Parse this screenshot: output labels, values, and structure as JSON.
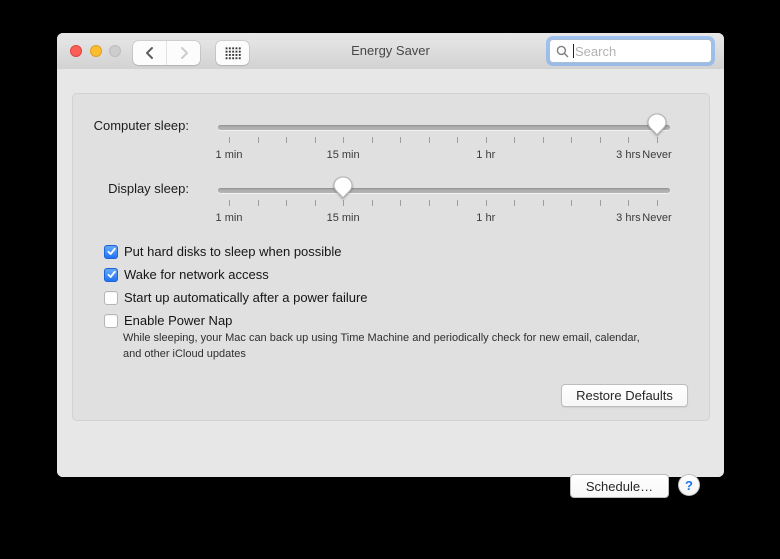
{
  "window": {
    "title": "Energy Saver"
  },
  "titlebar": {
    "close_label": "close",
    "minimize_label": "minimize",
    "zoom_label": "zoom-disabled",
    "search": {
      "placeholder": "Search"
    }
  },
  "sliders": {
    "tick_count": 16,
    "tick_labels": [
      {
        "text": "1 min",
        "tick": 0
      },
      {
        "text": "15 min",
        "tick": 4
      },
      {
        "text": "1 hr",
        "tick": 9
      },
      {
        "text": "3 hrs",
        "tick": 14
      },
      {
        "text": "Never",
        "tick": 15
      }
    ],
    "items": [
      {
        "id": "computer-sleep",
        "label": "Computer sleep:",
        "value": "Never",
        "thumb_tick": 15
      },
      {
        "id": "display-sleep",
        "label": "Display sleep:",
        "value": "15 min",
        "thumb_tick": 4
      }
    ]
  },
  "checkboxes": [
    {
      "label": "Put hard disks to sleep when possible",
      "checked": true
    },
    {
      "label": "Wake for network access",
      "checked": true
    },
    {
      "label": "Start up automatically after a power failure",
      "checked": false
    },
    {
      "label": "Enable Power Nap",
      "checked": false
    }
  ],
  "power_nap_note": "While sleeping, your Mac can back up using Time Machine and periodically check for new email, calendar, and other iCloud updates",
  "buttons": {
    "restore_defaults": "Restore Defaults",
    "schedule": "Schedule…",
    "help": "?"
  },
  "colors": {
    "checkbox_checked": "#2272f1",
    "focus_ring": "#6aa5f5",
    "traffic_red": "#f95f57",
    "traffic_yellow": "#fbbd2e",
    "traffic_gray": "#cdcdcd",
    "help_question": "#1d74e8"
  }
}
